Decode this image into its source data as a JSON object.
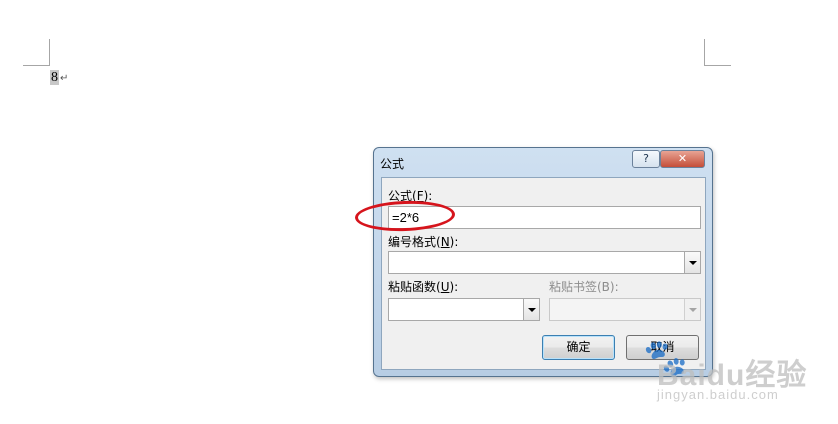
{
  "document": {
    "text": "8",
    "paragraph_mark": "↵"
  },
  "dialog": {
    "title": "公式",
    "help_button": "?",
    "close_button": "✕",
    "formula_label": "公式(",
    "formula_key": "F",
    "formula_label_end": "):",
    "formula_value": "=2*6",
    "number_format_label": "编号格式(",
    "number_format_key": "N",
    "number_format_label_end": "):",
    "number_format_value": "",
    "paste_function_label": "粘贴函数(",
    "paste_function_key": "U",
    "paste_function_label_end": "):",
    "paste_function_value": "",
    "paste_bookmark_label": "粘贴书签(B):",
    "paste_bookmark_value": "",
    "ok_button": "确定",
    "cancel_button": "取消"
  },
  "annotation": {
    "highlight_color": "#d6141c"
  },
  "watermark": {
    "brand": "Baidu经验",
    "url": "jingyan.baidu.com"
  }
}
